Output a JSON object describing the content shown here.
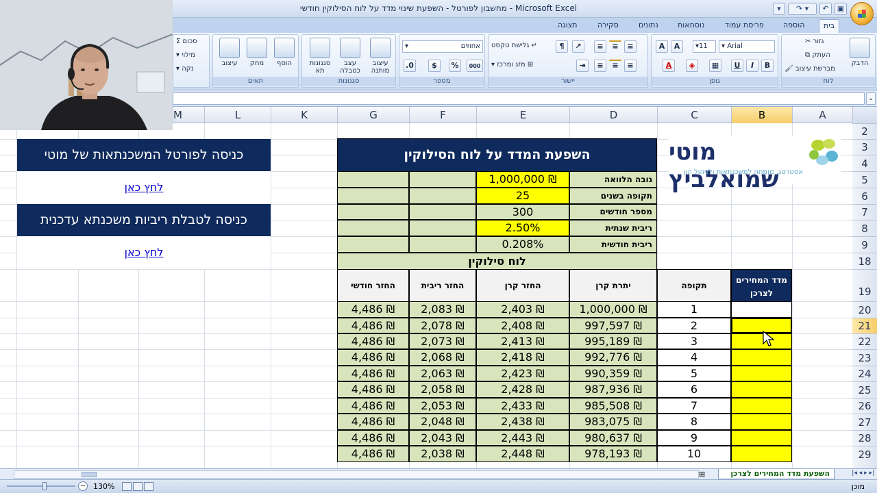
{
  "window": {
    "title": "מחשבון לפורטל - השפעת שינוי מדד על לוח הסילוקין חודשי - Microsoft Excel"
  },
  "tabs": [
    "בית",
    "הוספה",
    "פריסת עמוד",
    "נוסחאות",
    "נתונים",
    "סקירה",
    "תצוגה"
  ],
  "ribbon": {
    "clipboard": {
      "group": "לוח",
      "paste": "הדבק",
      "cut": "גזור",
      "copy": "העתק",
      "format_painter": "מברשת עיצוב"
    },
    "font": {
      "group": "גופן",
      "font_name": "Arial",
      "font_size": "11",
      "bold": "B",
      "italic": "I",
      "underline": "U"
    },
    "alignment": {
      "group": "יישור",
      "wrap_text": "גלישת טקסט",
      "merge_center": "מזג ומרכז"
    },
    "number": {
      "group": "מספר",
      "format": "אחוזים",
      "percent": "%",
      "comma": "000"
    },
    "styles": {
      "group": "סגנונות",
      "conditional": "עיצוב מותנה",
      "as_table": "עצב כטבלה",
      "cell_styles": "סגנונות תא"
    },
    "cells": {
      "group": "תאים",
      "insert": "הוסף",
      "delete": "מחק",
      "format": "עיצוב"
    },
    "editing": {
      "sum": "סכום",
      "fill": "מילוי",
      "clear": "נקה"
    }
  },
  "columns": [
    "A",
    "B",
    "C",
    "D",
    "E",
    "F",
    "G",
    "K",
    "L",
    "M"
  ],
  "rows": [
    "2",
    "3",
    "4",
    "5",
    "6",
    "7",
    "8",
    "9",
    "18",
    "19",
    "20",
    "21",
    "22",
    "23",
    "24",
    "25",
    "26",
    "27",
    "28",
    "29"
  ],
  "logo": {
    "name": "מוטי שמואלביץ",
    "tagline": "אסטרטג, מומחה למשכנתאות ולניהול הון"
  },
  "portal": {
    "box1": "כניסה לפורטל המשכנתאות של מוטי",
    "link1": "לחץ כאן",
    "box2": "כניסה לטבלת ריביות משכנתא עדכנית",
    "link2": "לחץ כאן"
  },
  "calc": {
    "title": "השפעת המדד על לוח הסילוקין",
    "rows": [
      {
        "label": "גובה הלוואה",
        "value": "1,000,000 ₪"
      },
      {
        "label": "תקופה בשנים",
        "value": "25"
      },
      {
        "label": "מספר חודשים",
        "value": "300"
      },
      {
        "label": "ריבית שנתית",
        "value": "2.50%"
      },
      {
        "label": "ריבית חודשית",
        "value": "0.208%"
      }
    ],
    "schedule_title": "לוח סילוקין",
    "headers": {
      "cpi": "מדד המחירים לצרכן",
      "period": "תקופה",
      "balance": "יתרת קרן",
      "principal": "החזר קרן",
      "interest": "החזר ריבית",
      "monthly": "החזר חודשי"
    },
    "schedule": [
      {
        "period": "1",
        "balance": "1,000,000 ₪",
        "principal": "2,403 ₪",
        "interest": "2,083 ₪",
        "monthly": "4,486 ₪"
      },
      {
        "period": "2",
        "balance": "997,597 ₪",
        "principal": "2,408 ₪",
        "interest": "2,078 ₪",
        "monthly": "4,486 ₪"
      },
      {
        "period": "3",
        "balance": "995,189 ₪",
        "principal": "2,413 ₪",
        "interest": "2,073 ₪",
        "monthly": "4,486 ₪"
      },
      {
        "period": "4",
        "balance": "992,776 ₪",
        "principal": "2,418 ₪",
        "interest": "2,068 ₪",
        "monthly": "4,486 ₪"
      },
      {
        "period": "5",
        "balance": "990,359 ₪",
        "principal": "2,423 ₪",
        "interest": "2,063 ₪",
        "monthly": "4,486 ₪"
      },
      {
        "period": "6",
        "balance": "987,936 ₪",
        "principal": "2,428 ₪",
        "interest": "2,058 ₪",
        "monthly": "4,486 ₪"
      },
      {
        "period": "7",
        "balance": "985,508 ₪",
        "principal": "2,433 ₪",
        "interest": "2,053 ₪",
        "monthly": "4,486 ₪"
      },
      {
        "period": "8",
        "balance": "983,075 ₪",
        "principal": "2,438 ₪",
        "interest": "2,048 ₪",
        "monthly": "4,486 ₪"
      },
      {
        "period": "9",
        "balance": "980,637 ₪",
        "principal": "2,443 ₪",
        "interest": "2,043 ₪",
        "monthly": "4,486 ₪"
      },
      {
        "period": "10",
        "balance": "978,193 ₪",
        "principal": "2,448 ₪",
        "interest": "2,038 ₪",
        "monthly": "4,486 ₪"
      }
    ]
  },
  "sheet_tab": "השפעת מדד המחירים לצרכן",
  "status": {
    "ready": "מוכן",
    "zoom": "130%"
  },
  "colors": {
    "navy": "#0f2a5c",
    "green": "#d8e4bc",
    "yellow": "#ffff00",
    "selection": "#f7cd6a"
  }
}
